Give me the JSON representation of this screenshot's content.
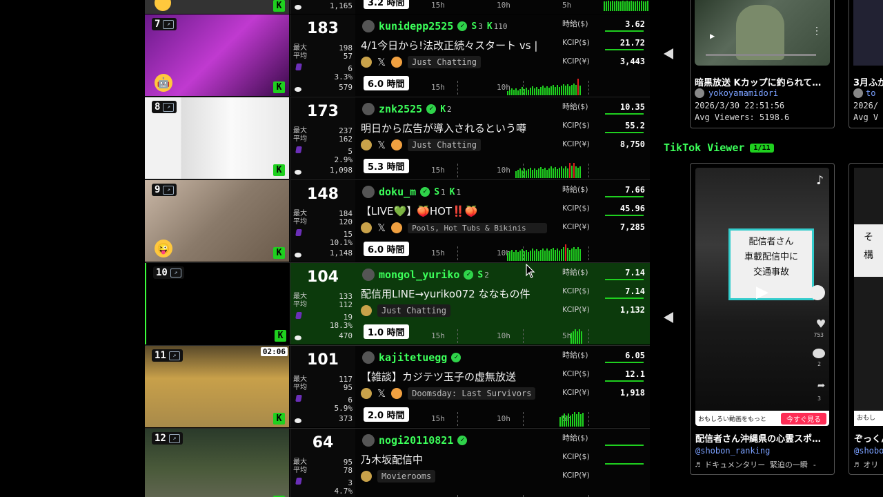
{
  "top_row": {
    "number": "1,165",
    "duration": "3.2 時間",
    "t15": "15h",
    "t10": "10h",
    "t5": "5h"
  },
  "streams": [
    {
      "rank": "7",
      "viewers": "183",
      "max": "198",
      "avg": "57",
      "subs": "6",
      "ratio": "3.3%",
      "chat": "579",
      "channel": "kunidepp2525",
      "s": "3",
      "k": "110",
      "title": "4/1今日から!法改正続々スタート vs |",
      "category": "Just Chatting",
      "has_x": true,
      "duration": "6.0 時間",
      "jpy_usd": "3.62",
      "kcip_usd": "21.72",
      "kcip_jpy": "3,443",
      "t15": "15h",
      "t10": "10h",
      "t5": ""
    },
    {
      "rank": "8",
      "viewers": "173",
      "max": "237",
      "avg": "162",
      "subs": "5",
      "ratio": "2.9%",
      "chat": "1,098",
      "channel": "znk2525",
      "s": "",
      "k": "2",
      "title": "明日から広告が導入されるという噂",
      "category": "Just Chatting",
      "has_x": true,
      "duration": "5.3 時間",
      "jpy_usd": "10.35",
      "kcip_usd": "55.2",
      "kcip_jpy": "8,750",
      "t15": "15h",
      "t10": "10h",
      "t5": ""
    },
    {
      "rank": "9",
      "viewers": "148",
      "max": "184",
      "avg": "120",
      "subs": "15",
      "ratio": "10.1%",
      "chat": "1,148",
      "channel": "doku_m",
      "s": "1",
      "k": "1",
      "title": "【LIVE💚】🍑HOT‼️🍑",
      "category": "Pools, Hot Tubs & Bikinis",
      "has_x": true,
      "duration": "6.0 時間",
      "jpy_usd": "7.66",
      "kcip_usd": "45.96",
      "kcip_jpy": "7,285",
      "t15": "15h",
      "t10": "10h",
      "t5": ""
    },
    {
      "rank": "10",
      "viewers": "104",
      "max": "133",
      "avg": "112",
      "subs": "19",
      "ratio": "18.3%",
      "chat": "470",
      "channel": "mongol_yuriko",
      "s": "2",
      "k": "",
      "title": "配信用LINE→yuriko072 ななもの件",
      "category": "Just Chatting",
      "has_x": false,
      "duration": "1.0 時間",
      "jpy_usd": "7.14",
      "kcip_usd": "7.14",
      "kcip_jpy": "1,132",
      "t15": "15h",
      "t10": "10h",
      "t5": "5h"
    },
    {
      "rank": "11",
      "viewers": "101",
      "max": "117",
      "avg": "95",
      "subs": "6",
      "ratio": "5.9%",
      "chat": "373",
      "channel": "kajitetuegg",
      "s": "",
      "k": "",
      "title": "【雑談】カジテツ玉子の虚無放送",
      "category": "Doomsday: Last Survivors",
      "has_x": true,
      "duration": "2.0 時間",
      "jpy_usd": "6.05",
      "kcip_usd": "12.1",
      "kcip_jpy": "1,918",
      "t15": "15h",
      "t10": "10h",
      "t5": "5h",
      "thumb_time": "02:06"
    },
    {
      "rank": "12",
      "viewers": "64",
      "max": "95",
      "avg": "78",
      "subs": "3",
      "ratio": "4.7%",
      "chat": "",
      "channel": "nogi20110821",
      "s": "",
      "k": "",
      "title": "乃木坂配信中",
      "category": "Movierooms",
      "has_x": false,
      "duration": "",
      "jpy_usd": "",
      "kcip_usd": "",
      "kcip_jpy": "",
      "t15": "",
      "t10": "",
      "t5": ""
    }
  ],
  "labels": {
    "max": "最大",
    "avg": "平均",
    "jpy_usd": "時給($)",
    "kcip_usd": "KCIP($)",
    "kcip_jpy": "KCIP(¥)"
  },
  "kick_cards": [
    {
      "title": "暗黒放送 Kカップに釣られて…",
      "user": "yokoyamamidori",
      "date": "2026/3/30 22:51:56",
      "avg": "Avg Viewers: 5198.6"
    },
    {
      "title": "3月ふか",
      "user": "to",
      "date": "2026/",
      "avg": "Avg V"
    }
  ],
  "tiktok": {
    "section_title": "TikTok Viewer",
    "counter": "1/11",
    "overlay_text": "配信者さん\n車載配信中に\n交通事故",
    "banner_left": "おもしろい動画をもっと",
    "banner_button": "今すぐ見る",
    "likes": "753",
    "comments": "2",
    "shares": "3",
    "cards": [
      {
        "title": "配信者さん沖縄県の心霊スポ…",
        "user": "@shobon_ranking",
        "music": "♬ ドキュメンタリー 緊迫の一瞬 -"
      },
      {
        "title": "ぞっくん",
        "user": "@shobo",
        "music": "♬ オリ"
      }
    ],
    "second_banner": "おもし",
    "second_overlay": "そ\n構"
  }
}
